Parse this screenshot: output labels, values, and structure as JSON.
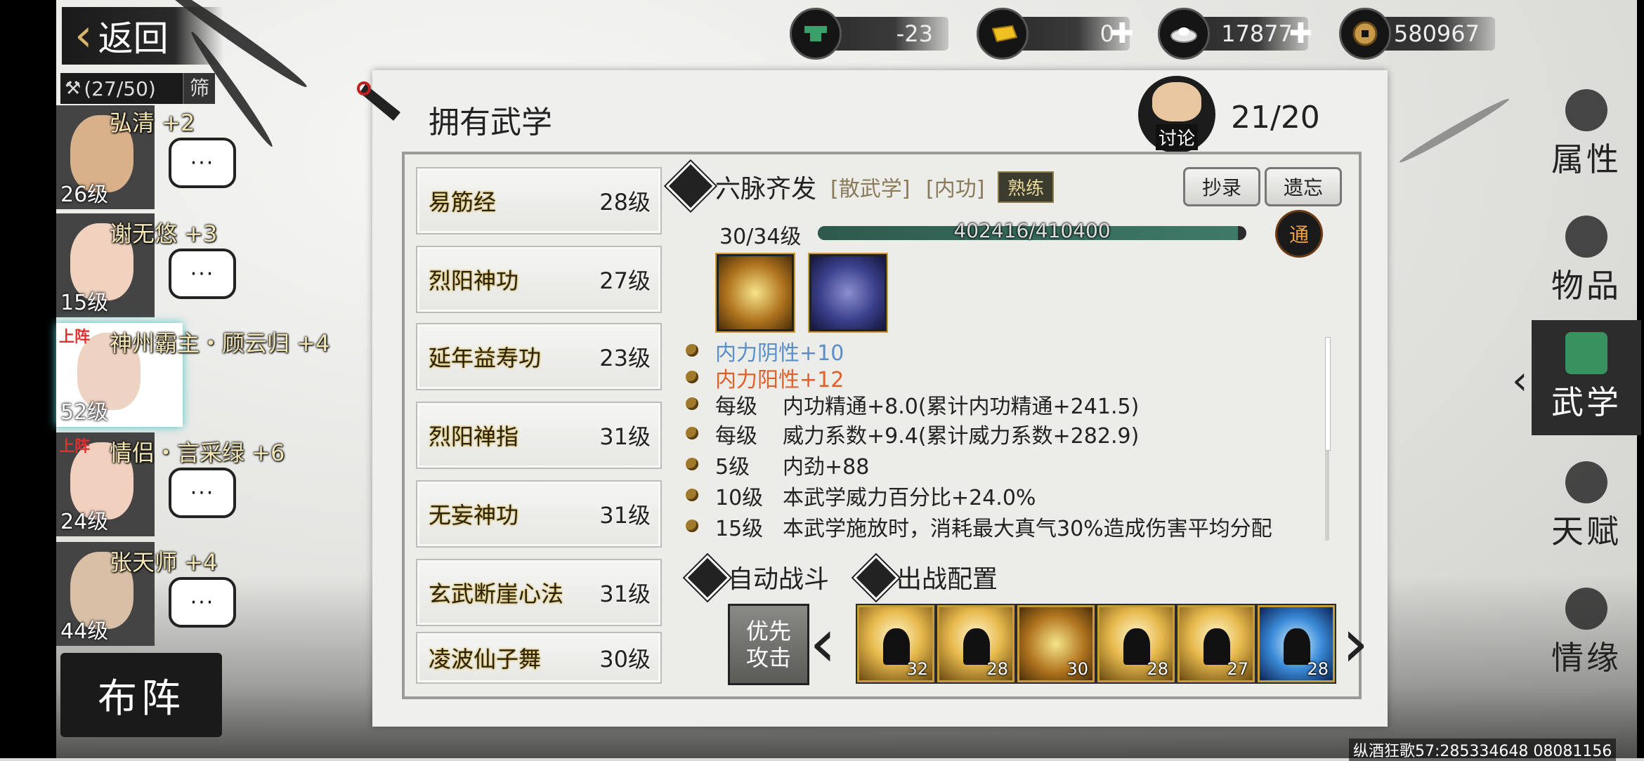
{
  "topbar": {
    "back_label": "返回",
    "resources": [
      {
        "icon": "anvil-icon",
        "value": "-23",
        "has_plus": false
      },
      {
        "icon": "gold-bar-icon",
        "value": "0",
        "has_plus": true
      },
      {
        "icon": "silver-ingot-icon",
        "value": "17877",
        "has_plus": true
      },
      {
        "icon": "copper-coin-icon",
        "value": "580967",
        "has_plus": true
      }
    ]
  },
  "roster": {
    "count": "(27/50)",
    "filter_label": "筛",
    "heroes": [
      {
        "name": "弘清 +2",
        "level": "26级",
        "deployed": "",
        "chat": "···"
      },
      {
        "name": "谢无悠 +3",
        "level": "15级",
        "deployed": "",
        "chat": "···"
      },
      {
        "name": "神州霸主・顾云归 +4",
        "level": "52级",
        "deployed": "上阵",
        "chat": ""
      },
      {
        "name": "情侣・言采绿 +6",
        "level": "24级",
        "deployed": "上阵",
        "chat": "···"
      },
      {
        "name": "张天师 +4",
        "level": "44级",
        "deployed": "",
        "chat": "···"
      }
    ],
    "formation_label": "布阵"
  },
  "panel": {
    "title": "拥有武学",
    "discuss_label": "讨论",
    "count": "21/20"
  },
  "skills": [
    {
      "name": "易筋经",
      "level": "28级"
    },
    {
      "name": "烈阳神功",
      "level": "27级"
    },
    {
      "name": "延年益寿功",
      "level": "23级"
    },
    {
      "name": "烈阳禅指",
      "level": "31级"
    },
    {
      "name": "无妄神功",
      "level": "31级"
    },
    {
      "name": "玄武断崖心法",
      "level": "31级"
    },
    {
      "name": "凌波仙子舞",
      "level": "30级"
    }
  ],
  "detail": {
    "name": "六脉齐发",
    "tag1": "[散武学]",
    "tag2": "[内功]",
    "proficiency": "熟练",
    "copy_label": "抄录",
    "forget_label": "遗忘",
    "level": "30/34级",
    "exp_text": "402416/410400",
    "exp_fraction": 0.9805,
    "tong_label": "通",
    "attrs": [
      {
        "k": "",
        "v": "内力阴性+10",
        "color": "#5a8fc8"
      },
      {
        "k": "",
        "v": "内力阳性+12",
        "color": "#e0602a"
      },
      {
        "k": "每级",
        "v": "内功精通+8.0(累计内功精通+241.5)",
        "color": "#222222"
      },
      {
        "k": "每级",
        "v": "威力系数+9.4(累计威力系数+282.9)",
        "color": "#222222"
      },
      {
        "k": "5级",
        "v": "内劲+88",
        "color": "#222222"
      },
      {
        "k": "10级",
        "v": "本武学威力百分比+24.0%",
        "color": "#222222"
      },
      {
        "k": "15级",
        "v": "本武学施放时，消耗最大真气30%造成伤害平均分配",
        "color": "#222222"
      }
    ],
    "auto_battle_label": "自动战斗",
    "battle_config_label": "出战配置",
    "priority_label": "优先\n攻击",
    "slots": [
      "32",
      "28",
      "30",
      "28",
      "27",
      "28"
    ]
  },
  "right_tabs": [
    {
      "label": "属性",
      "icon": "fist-icon"
    },
    {
      "label": "物品",
      "icon": "box-icon"
    },
    {
      "label": "武学",
      "icon": "scroll-icon",
      "active": true
    },
    {
      "label": "天赋",
      "icon": "tree-icon"
    },
    {
      "label": "情缘",
      "icon": "heart-icon"
    }
  ],
  "footer": "纵酒狂歌57:285334648 08081156"
}
